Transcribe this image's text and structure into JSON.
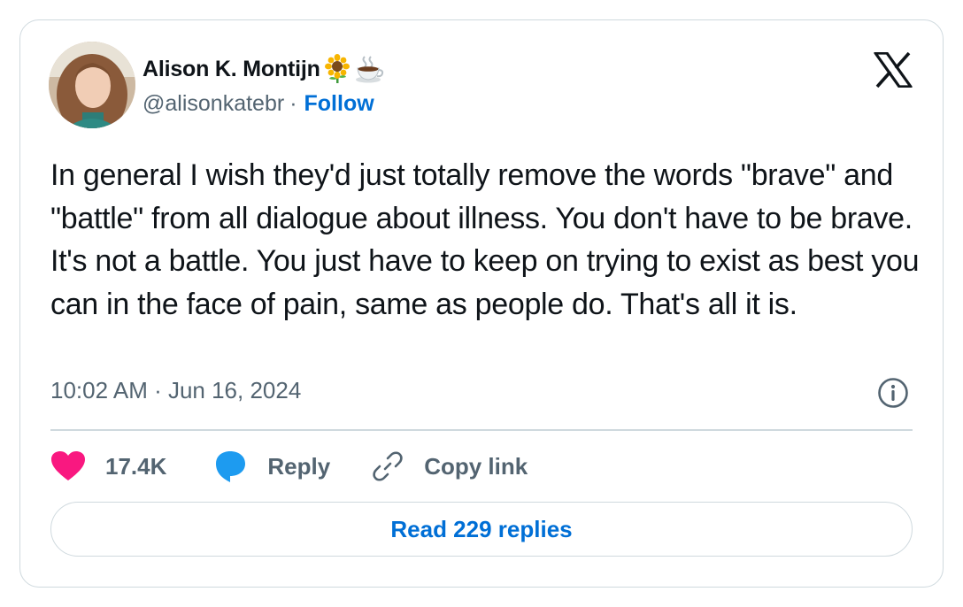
{
  "author": {
    "name": "Alison K. Montijn",
    "emojis": [
      "sunflower",
      "hot-beverage"
    ],
    "handle": "@alisonkatebr",
    "separator": "·",
    "follow_label": "Follow"
  },
  "tweet": {
    "text": "In general I wish they'd just totally remove the words \"brave\" and \"battle\" from all dialogue about illness. You don't have to be brave. It's not a battle. You just have to keep on trying to exist as best you can in the face of pain, same as people do. That's all it is.",
    "timestamp": "10:02 AM · Jun 16, 2024"
  },
  "actions": {
    "like_count": "17.4K",
    "reply_label": "Reply",
    "copy_link_label": "Copy link"
  },
  "read_replies_label": "Read 229 replies",
  "icons": {
    "logo": "x-logo-icon",
    "info": "info-icon",
    "like": "heart-icon",
    "reply": "speech-bubble-icon",
    "copy": "link-icon"
  },
  "colors": {
    "text": "#0f1419",
    "secondary": "#536471",
    "link": "#006fd6",
    "heart": "#f91880",
    "reply_bubble": "#1d9bf0",
    "border": "#cfd9de"
  }
}
